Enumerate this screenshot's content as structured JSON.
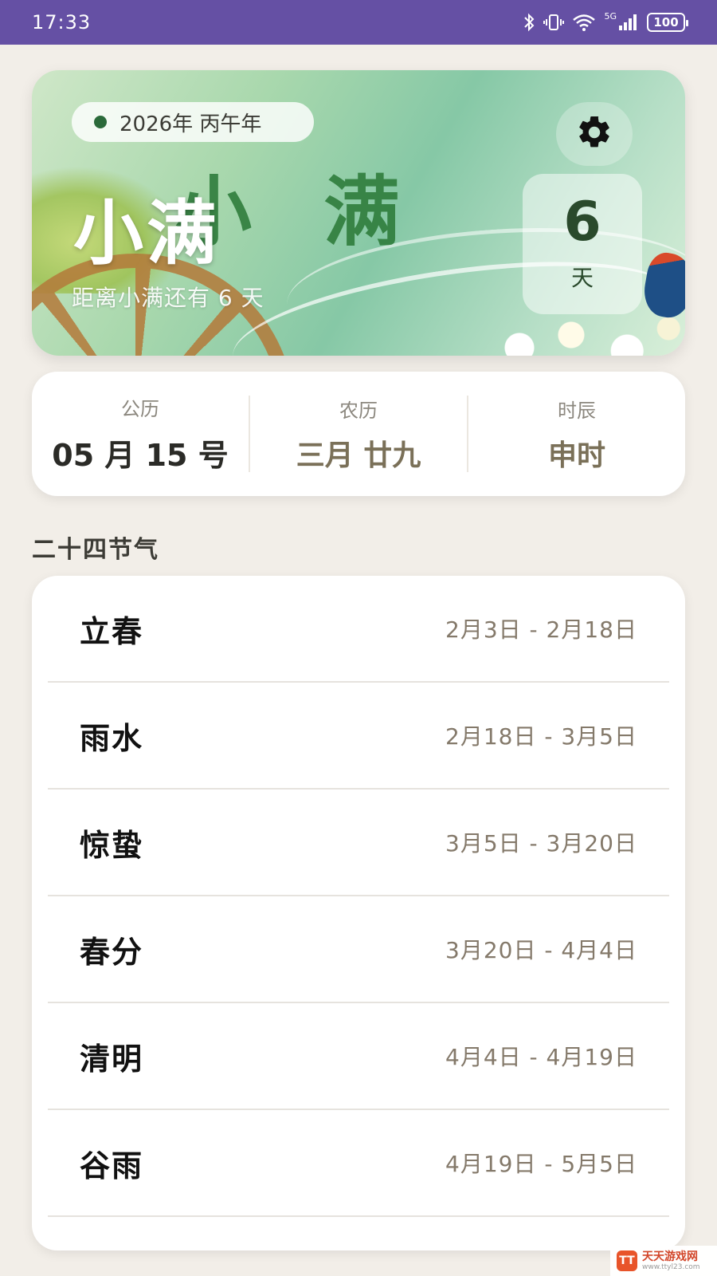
{
  "status_bar": {
    "time": "17:33",
    "network": "5G",
    "battery": "100"
  },
  "hero": {
    "year_label": "2026年 丙午年",
    "background_title": "小满",
    "title": "小满",
    "subtitle": "距离小满还有 6 天",
    "days_count": "6",
    "days_unit": "天"
  },
  "date_info": {
    "solar_label": "公历",
    "solar_value": "05 月 15 号",
    "lunar_label": "农历",
    "lunar_value": "三月 廿九",
    "hour_label": "时辰",
    "hour_value": "申时"
  },
  "section_title": "二十四节气",
  "solar_terms": [
    {
      "name": "立春",
      "range": "2月3日 - 2月18日"
    },
    {
      "name": "雨水",
      "range": "2月18日 - 3月5日"
    },
    {
      "name": "惊蛰",
      "range": "3月5日 - 3月20日"
    },
    {
      "name": "春分",
      "range": "3月20日 - 4月4日"
    },
    {
      "name": "清明",
      "range": "4月4日 - 4月19日"
    },
    {
      "name": "谷雨",
      "range": "4月19日 - 5月5日"
    }
  ],
  "watermark": {
    "name": "天天游戏网",
    "url": "www.ttyl23.com"
  },
  "colors": {
    "status_bar": "#6550a4",
    "background": "#f2eee8",
    "accent_green": "#2b6a3a",
    "muted_text": "#84796a"
  },
  "icons": [
    "bluetooth-icon",
    "vibrate-icon",
    "wifi-icon",
    "signal-icon",
    "battery-icon",
    "gear-icon"
  ]
}
